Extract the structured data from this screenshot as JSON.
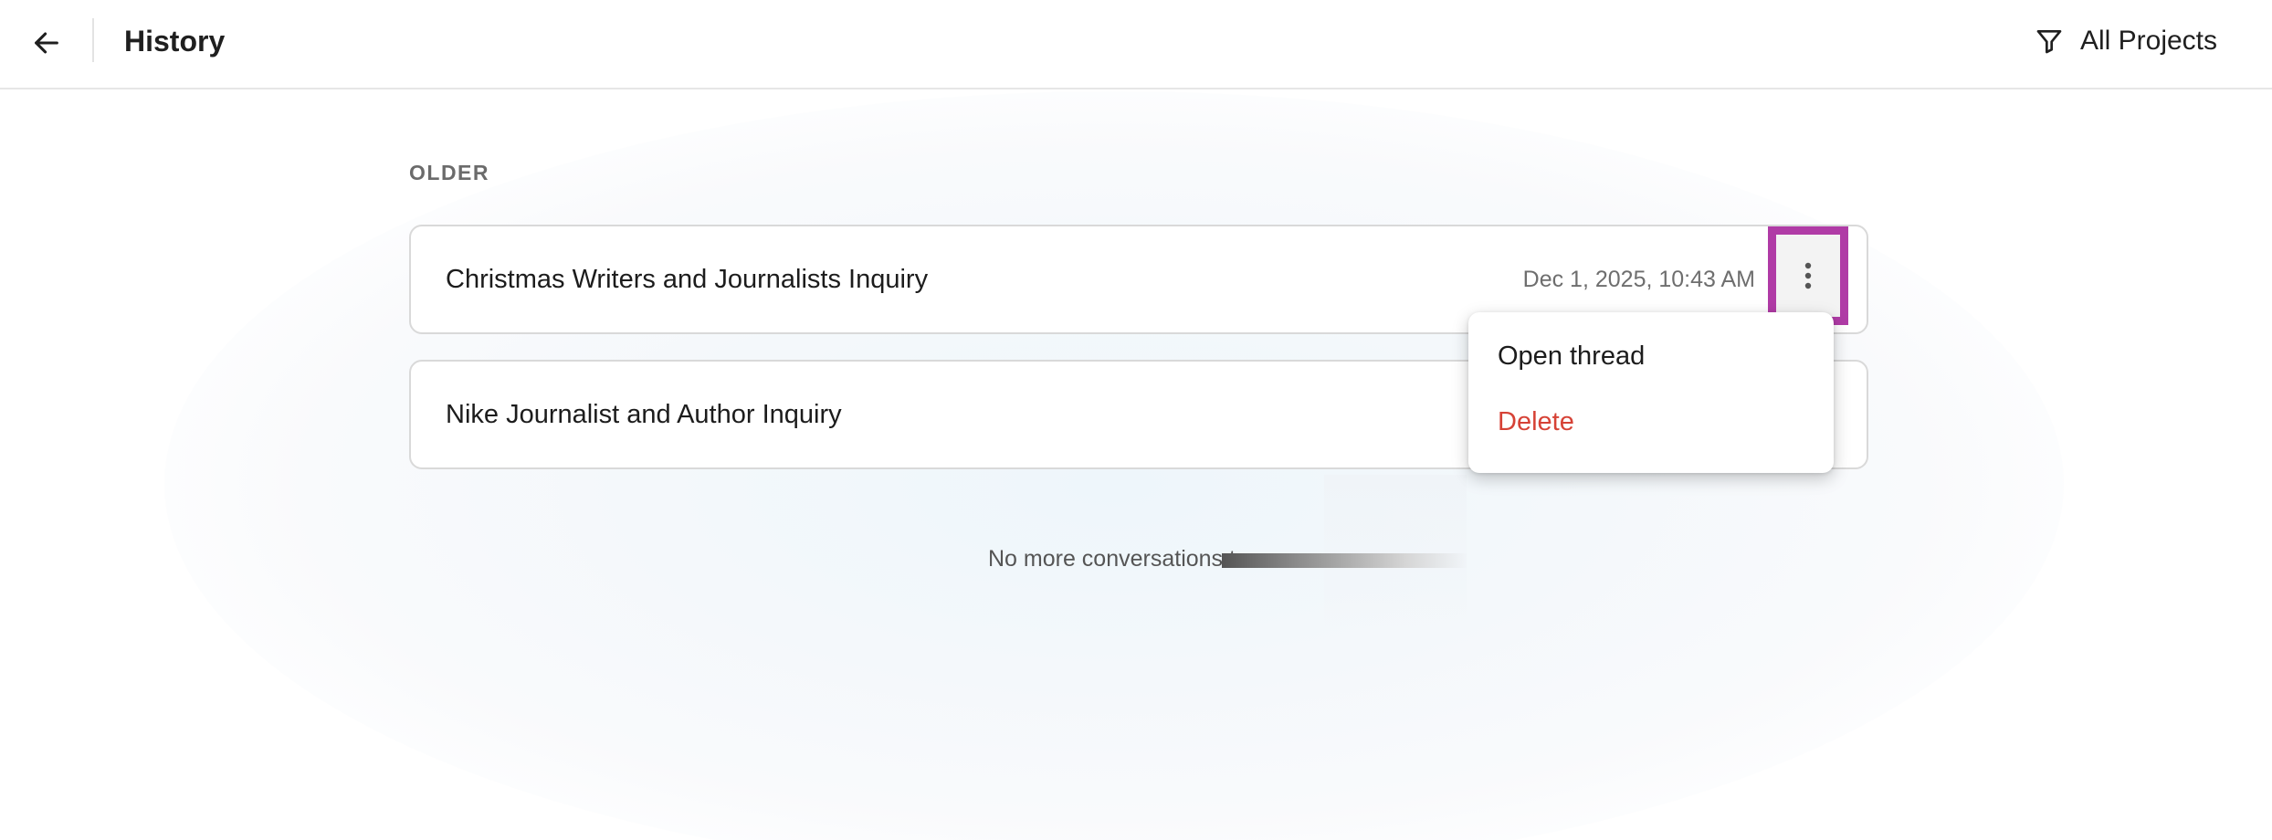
{
  "header": {
    "title": "History",
    "filter_label": "All Projects"
  },
  "icons": {
    "back": "arrow-left-icon",
    "filter": "funnel-icon",
    "more": "vertical-ellipsis-icon"
  },
  "section": {
    "label": "OLDER"
  },
  "threads": [
    {
      "title": "Christmas Writers and Journalists Inquiry",
      "date": "Dec 1, 2025, 10:43 AM"
    },
    {
      "title": "Nike Journalist and Author Inquiry",
      "date": ""
    }
  ],
  "context_menu": {
    "open_label": "Open thread",
    "delete_label": "Delete"
  },
  "end_note": "No more conversations t",
  "colors": {
    "highlight": "#b03ba6",
    "delete": "#d64236",
    "muted": "#6e6e6e"
  }
}
